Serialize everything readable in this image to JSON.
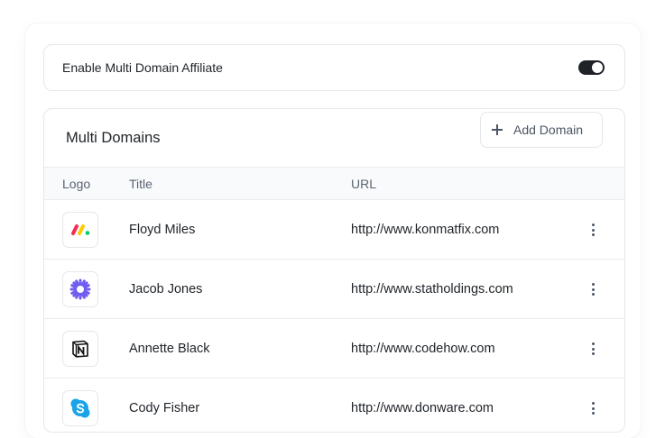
{
  "settings": {
    "toggle_label": "Enable Multi Domain Affiliate",
    "toggle_on": true
  },
  "domains": {
    "title": "Multi Domains",
    "add_label": "Add Domain",
    "columns": {
      "logo": "Logo",
      "title": "Title",
      "url": "URL"
    },
    "rows": [
      {
        "logo": "monday-logo",
        "title": "Floyd Miles",
        "url": "http://www.konmatfix.com"
      },
      {
        "logo": "zapier-logo",
        "title": "Jacob Jones",
        "url": "http://www.statholdings.com"
      },
      {
        "logo": "notion-logo",
        "title": "Annette Black",
        "url": "http://www.codehow.com"
      },
      {
        "logo": "skype-logo",
        "title": "Cody Fisher",
        "url": "http://www.donware.com"
      }
    ]
  },
  "colors": {
    "toggle_active": "#1f2328",
    "monday_red": "#f62b54",
    "monday_yellow": "#ffcc00",
    "monday_green": "#00ca72",
    "zapier_purple": "#6f5cf0",
    "skype_blue": "#1aa3e8"
  }
}
